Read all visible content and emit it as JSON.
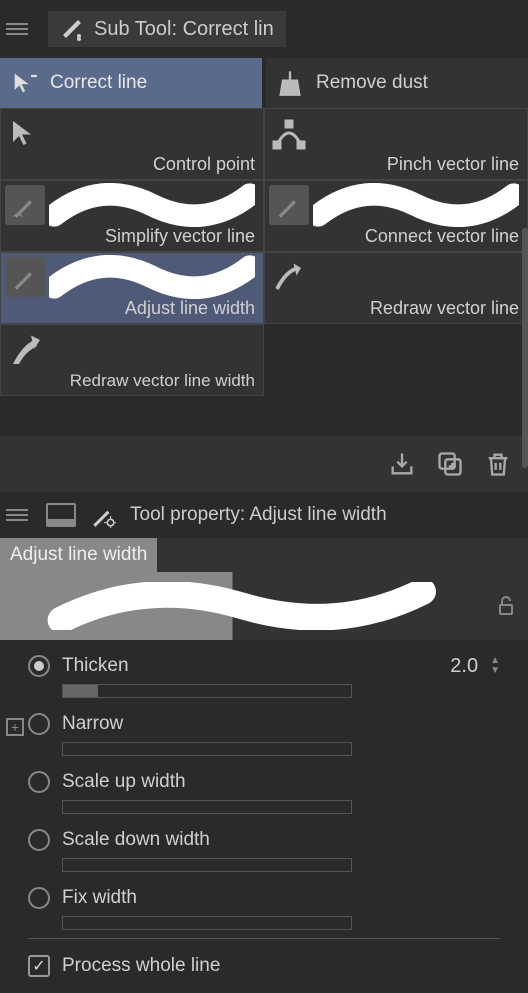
{
  "header": {
    "title": "Sub Tool: Correct lin"
  },
  "tabs": {
    "correct_line": "Correct line",
    "remove_dust": "Remove dust"
  },
  "tools": {
    "control_point": "Control point",
    "pinch_vector": "Pinch vector line",
    "simplify_vector": "Simplify vector line",
    "connect_vector": "Connect vector line",
    "adjust_width": "Adjust line width",
    "redraw_vector": "Redraw vector line",
    "redraw_width": "Redraw vector line width"
  },
  "property": {
    "title": "Tool property: Adjust line width",
    "preview_label": "Adjust line width"
  },
  "options": {
    "thicken": {
      "label": "Thicken",
      "value": "2.0",
      "fill_pct": 12
    },
    "narrow": {
      "label": "Narrow",
      "fill_pct": 0
    },
    "scale_up": {
      "label": "Scale up width",
      "fill_pct": 0
    },
    "scale_down": {
      "label": "Scale down width",
      "fill_pct": 0
    },
    "fix_width": {
      "label": "Fix width",
      "fill_pct": 0
    }
  },
  "process_whole_line": "Process whole line"
}
